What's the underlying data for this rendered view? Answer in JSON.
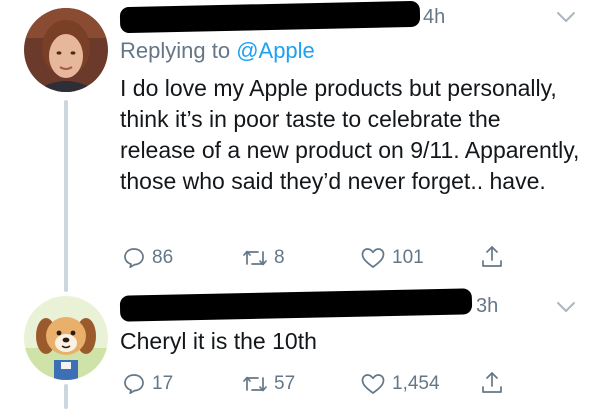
{
  "tweets": [
    {
      "time": "4h",
      "replying_prefix": "Replying to ",
      "replying_handle": "@Apple",
      "text": "I do love my Apple products but personally, think it’s in poor taste to celebrate the release of a new product on 9/11.  Apparently, those who said they’d never forget.. have.",
      "reply_count": "86",
      "retweet_count": "8",
      "like_count": "101"
    },
    {
      "time": "3h",
      "text": "Cheryl it is the 10th",
      "reply_count": "17",
      "retweet_count": "57",
      "like_count": "1,454"
    }
  ],
  "icons": {
    "reply": "speech-bubble-icon",
    "retweet": "retweet-arrows-icon",
    "like": "heart-outline-icon",
    "share": "share-upload-icon",
    "menu": "chevron-down-icon"
  },
  "colors": {
    "link": "#1da1f2",
    "secondary_text": "#657786",
    "primary_text": "#14171a",
    "thread_line": "#ccd6dd"
  }
}
